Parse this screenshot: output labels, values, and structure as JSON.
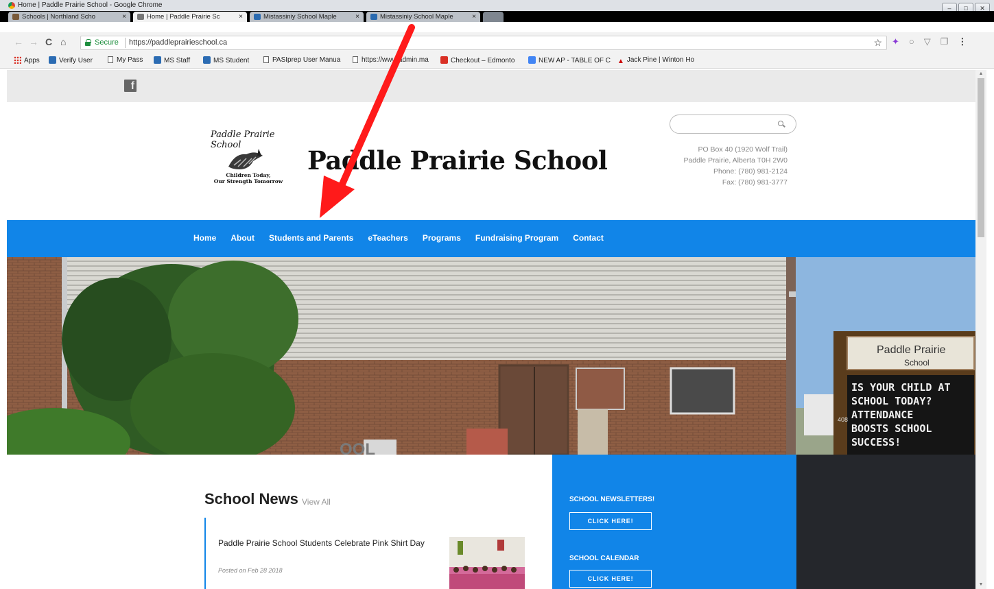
{
  "window": {
    "title": "Home | Paddle Prairie School - Google Chrome",
    "controls": [
      "–",
      "□",
      "✕"
    ]
  },
  "tabs": [
    {
      "label": "Schools | Northland Scho",
      "close": "×",
      "icon_color": "#7a5a3a",
      "active": false
    },
    {
      "label": "Home | Paddle Prairie Sc",
      "close": "×",
      "icon_color": "#777777",
      "active": true
    },
    {
      "label": "Mistassiniy School Maple",
      "close": "×",
      "icon_color": "#2a6ab0",
      "active": false
    },
    {
      "label": "Mistassiniy School Maple",
      "close": "×",
      "icon_color": "#2a6ab0",
      "active": false
    }
  ],
  "toolbar": {
    "back_icon": "←",
    "forward_icon": "→",
    "reload_icon": "C",
    "home_icon": "⌂",
    "secure_label": "Secure",
    "url": "https://paddleprairieschool.ca",
    "star_icon": "☆",
    "extension_icons": [
      "✦",
      "○",
      "▽",
      "❐",
      "⋮"
    ]
  },
  "bookmarks": [
    {
      "label": "Apps",
      "icon": "apps-icon"
    },
    {
      "label": "Verify User",
      "icon": "bookmark-blue-icon"
    },
    {
      "label": "My Pass",
      "icon": "page-icon"
    },
    {
      "label": "MS Staff",
      "icon": "bookmark-blue-icon"
    },
    {
      "label": "MS Student",
      "icon": "bookmark-blue-icon"
    },
    {
      "label": "PASIprep User Manua",
      "icon": "page-icon"
    },
    {
      "label": "https://www.admin.ma",
      "icon": "page-icon"
    },
    {
      "label": "Checkout – Edmonto",
      "icon": "bookmark-red-icon"
    },
    {
      "label": "NEW AP - TABLE OF C",
      "icon": "docs-icon"
    },
    {
      "label": "Jack Pine | Winton Ho",
      "icon": "bookmark-arrow-icon"
    }
  ],
  "site": {
    "social_icon": "f",
    "logo_top": "Paddle Prairie School",
    "logo_bottom_1": "Children Today,",
    "logo_bottom_2": "Our Strength Tomorrow",
    "title": "Paddle Prairie School",
    "address": [
      "PO Box 40 (1920 Wolf Trail)",
      "Paddle Prairie, Alberta T0H 2W0",
      "Phone: (780) 981-2124",
      "Fax: (780) 981-3777"
    ],
    "nav": [
      "Home",
      "About",
      "Students and Parents",
      "eTeachers",
      "Programs",
      "Fundraising Program",
      "Contact"
    ],
    "hero_sign": {
      "name_1": "Paddle Prairie",
      "name_2": "School",
      "lines": [
        "IS YOUR CHILD AT",
        "SCHOOL TODAY?",
        "ATTENDANCE",
        "BOOSTS  SCHOOL",
        "SUCCESS!"
      ],
      "wall_letters": "OOL",
      "post_number": "408"
    }
  },
  "news": {
    "title": "School News",
    "view_all": "View All",
    "items": [
      {
        "headline": "Paddle Prairie School Students Celebrate Pink Shirt Day",
        "date": "Posted on Feb 28 2018"
      }
    ]
  },
  "sidebar": {
    "newsletters_heading": "SCHOOL NEWSLETTERS!",
    "newsletters_button": "CLICK HERE!",
    "calendar_heading": "SCHOOL CALENDAR",
    "calendar_button": "CLICK HERE!"
  },
  "colors": {
    "nav_blue": "#1185e8",
    "dark_panel": "#25272c",
    "annotation_arrow": "#ff1a1a"
  }
}
